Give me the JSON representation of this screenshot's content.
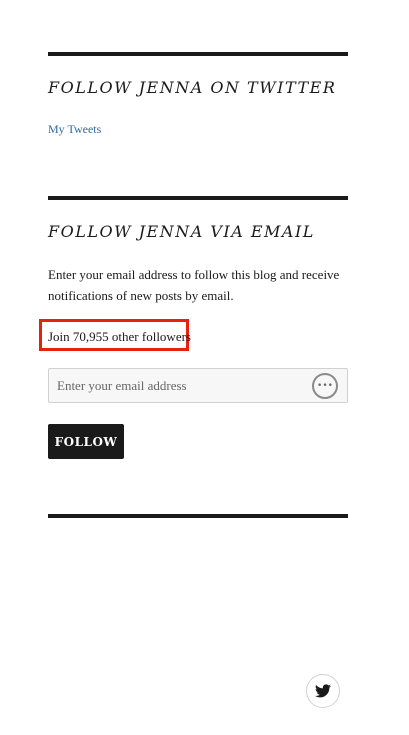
{
  "twitter_widget": {
    "title": "FOLLOW JENNA ON TWITTER",
    "link_label": "My Tweets"
  },
  "email_widget": {
    "title": "FOLLOW JENNA VIA EMAIL",
    "description": "Enter your email address to follow this blog and receive notifications of new posts by email.",
    "followers_text": "Join 70,955 other followers",
    "email_placeholder": "Enter your email address",
    "email_value": "",
    "input_icon": "more-dots-icon",
    "follow_label": "FOLLOW",
    "highlight_color": "#e8200e"
  },
  "footer": {
    "social_icon": "twitter-icon"
  },
  "colors": {
    "text": "#1a1a1a",
    "link": "#2f6aa3",
    "button_bg": "#1a1a1a",
    "input_bg": "#f7f7f7"
  }
}
